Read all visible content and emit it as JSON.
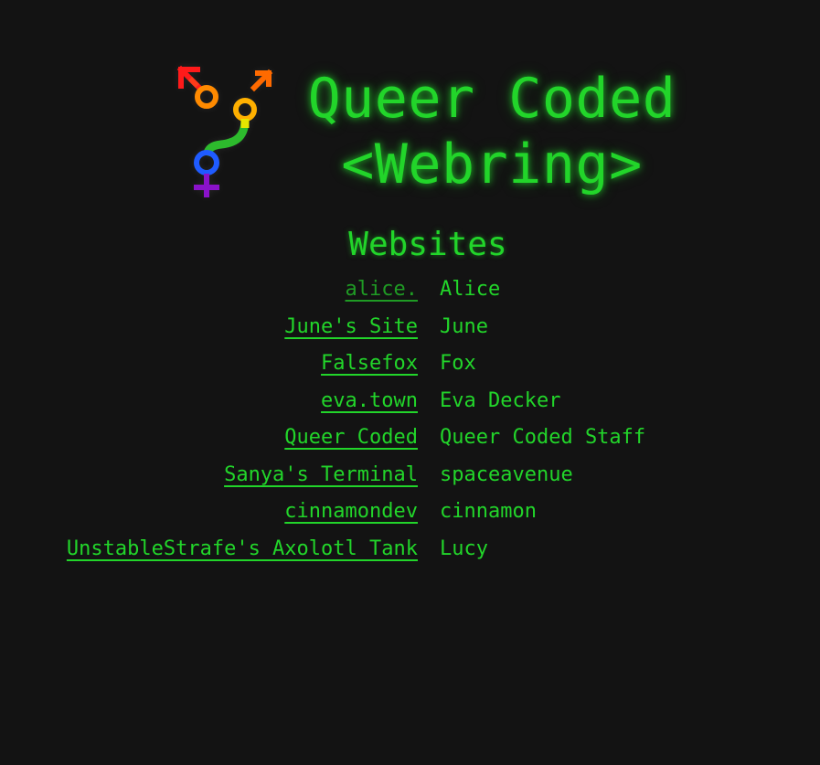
{
  "header": {
    "title_line1": "Queer Coded",
    "title_line2": "<Webring>",
    "logo_icon": "rainbow-gender-symbols-logo-icon"
  },
  "websites": {
    "heading": "Websites",
    "items": [
      {
        "name": "alice.",
        "owner": "Alice",
        "visited": true
      },
      {
        "name": "June's Site",
        "owner": "June"
      },
      {
        "name": "Falsefox",
        "owner": "Fox"
      },
      {
        "name": "eva.town",
        "owner": "Eva Decker"
      },
      {
        "name": "Queer Coded",
        "owner": "Queer Coded Staff"
      },
      {
        "name": "Sanya's Terminal",
        "owner": "spaceavenue"
      },
      {
        "name": "cinnamondev",
        "owner": "cinnamon"
      },
      {
        "name": "UnstableStrafe's Axolotl Tank",
        "owner": "Lucy"
      }
    ]
  },
  "colors": {
    "background": "#131313",
    "accent": "#22d52a",
    "visited_link": "#1f9b24"
  }
}
